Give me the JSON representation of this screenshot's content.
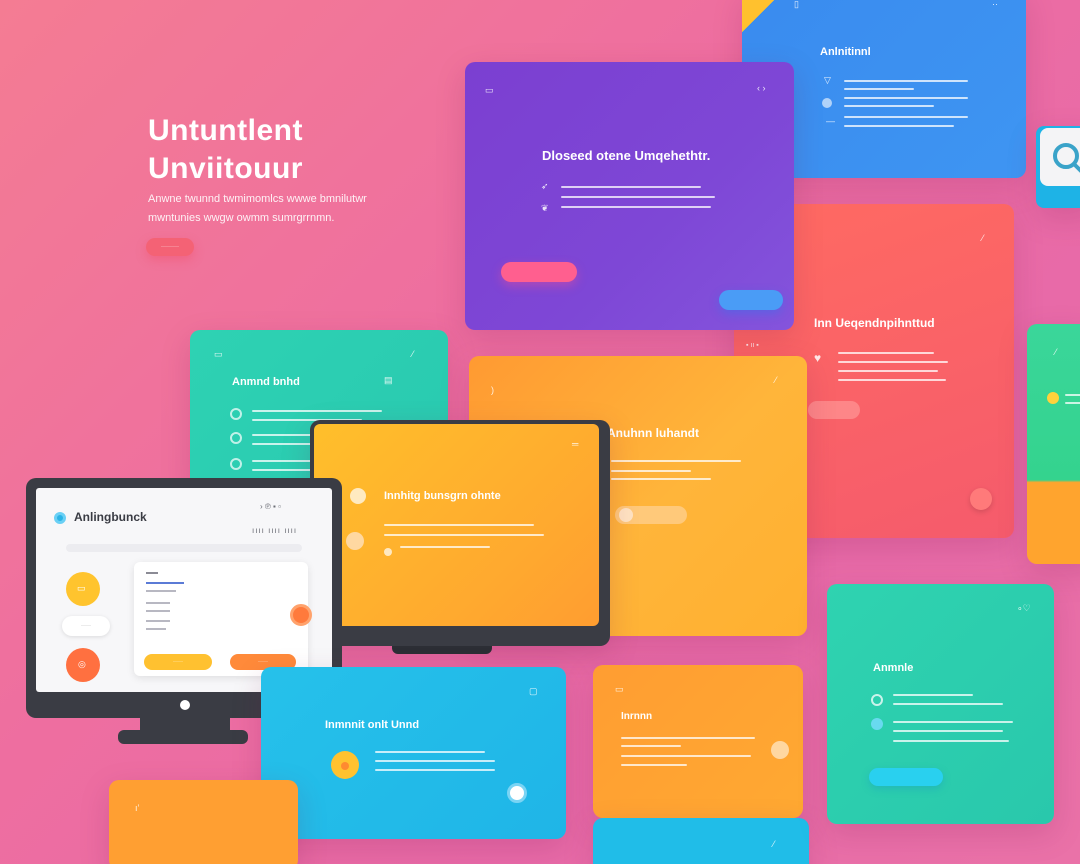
{
  "hero": {
    "title_line1": "Untuntlent",
    "title_line2": "Unviitouur",
    "subtitle_line1": "Anwne twunnd twmimomlcs wwwe bmnilutwr",
    "subtitle_line2": "mwntunies wwgw owmm sumrgrrnmn.",
    "cta": "·········"
  },
  "cards": {
    "purple": {
      "title": "Dloseed otene Umqehethtr."
    },
    "blue_top": {
      "title": "Anlnitinnl"
    },
    "red": {
      "title": "Inn Ueqendnpihnttud"
    },
    "teal_left": {
      "title": "Anmnd bnhd"
    },
    "orange_mid": {
      "title": "Anuhnn luhandt"
    },
    "yellow_laptop": {
      "title": "Innhitg bunsgrn ohnte"
    },
    "monitor": {
      "app_title": "Anlingbunck",
      "toolbar_text": "ıııı ıııı ıııı"
    },
    "blue_bottom": {
      "title": "Inmnnit onlt Unnd"
    },
    "orange_bottom": {
      "title": "Inrnnn"
    },
    "teal_right": {
      "title": "Anmnle"
    }
  },
  "colors": {
    "purple": "#7a45d2",
    "blue": "#3c8ef0",
    "red": "#f5606a",
    "teal": "#2fcfae",
    "orange": "#ffa532",
    "yellow": "#ffbf2b",
    "cyan": "#24bde8",
    "pink_button": "#ff5f8f"
  },
  "icons": [
    "search-icon",
    "monitor-icon",
    "chat-icon",
    "diamond-icon",
    "circle-icon"
  ]
}
